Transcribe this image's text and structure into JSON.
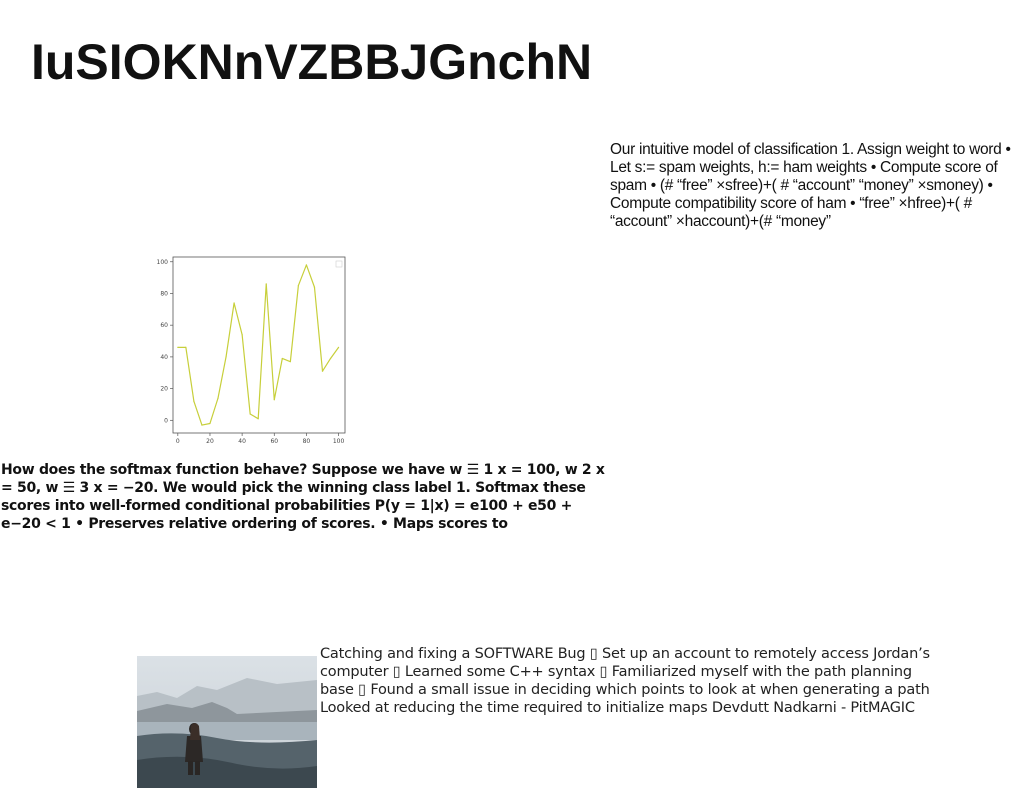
{
  "title": "IuSIOKNnVZBBJGnchN",
  "paragraphs": {
    "classification": "Our intuitive model of classification 1. Assign weight to word • Let s:= spam weights, h:= ham weights • Compute score of spam • (# “free” ×sfree)+( # “account” “money” ×smoney) • Compute compatibility score of ham • “free” ×hfree)+( # “account” ×haccount)+(# “money”",
    "softmax": "How does the softmax function behave? Suppose we have w ☰ 1 x = 100, w 2 x = 50, w ☰ 3 x = −20. We would pick the winning class label 1. Softmax these scores into well-formed conditional probabilities P(y = 1|x) = e100 + e50 + e−20 < 1 • Preserves relative ordering of scores. • Maps scores to",
    "software_bug": "Catching and fixing a SOFTWARE Bug ▯ Set up an account to remotely access Jordan’s computer ▯ Learned some C++ syntax ▯ Familiarized myself with the path planning base ▯ Found a small issue in deciding which points to look at when generating a path Looked at reducing the time required to initialize maps Devdutt Nadkarni - PitMAGIC"
  },
  "chart_data": {
    "type": "line",
    "x": [
      0,
      5,
      10,
      15,
      20,
      25,
      30,
      35,
      40,
      45,
      50,
      55,
      60,
      65,
      70,
      75,
      80,
      85,
      90,
      95,
      100
    ],
    "series": [
      {
        "values": [
          46,
          46,
          12,
          -3,
          -2,
          14,
          40,
          74,
          54,
          4,
          1,
          86,
          13,
          39,
          37,
          85,
          98,
          84,
          31,
          39,
          46
        ]
      }
    ],
    "xticks": [
      "0",
      "20",
      "40",
      "60",
      "80",
      "100"
    ],
    "yticks": [
      "0",
      "20",
      "40",
      "60",
      "80",
      "100"
    ],
    "xlim": [
      -3,
      104
    ],
    "ylim": [
      -8,
      103
    ],
    "grid": false,
    "line_color": "#c7cf3a"
  }
}
